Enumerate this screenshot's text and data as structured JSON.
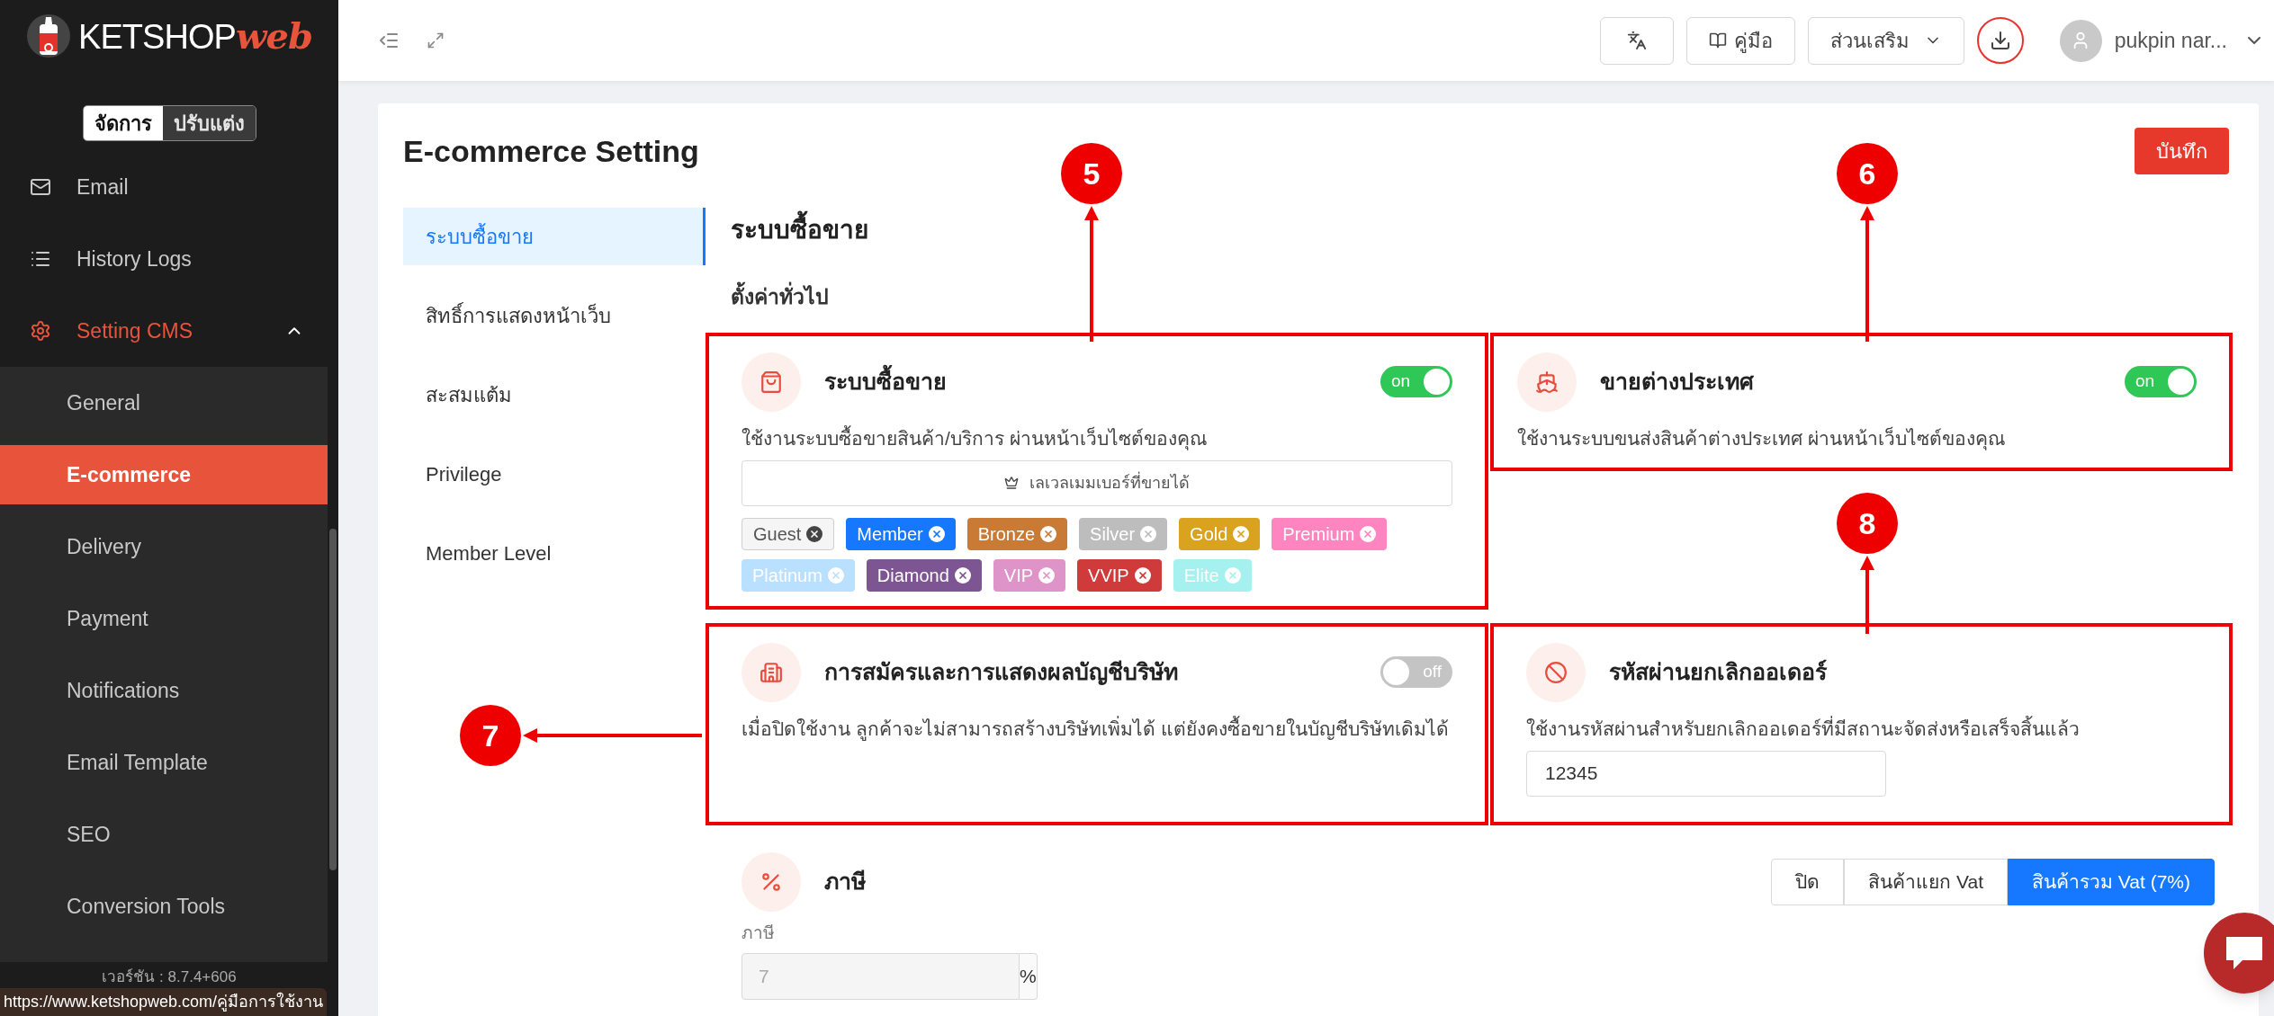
{
  "sidebar": {
    "logo": {
      "text": "KETSHOP",
      "accent": "web"
    },
    "mode_switch": [
      {
        "label": "จัดการ",
        "selected": true
      },
      {
        "label": "ปรับแต่ง",
        "selected": false
      }
    ],
    "items": [
      {
        "label": "Email",
        "selected": false
      },
      {
        "label": "History Logs",
        "selected": false
      },
      {
        "label": "Setting CMS",
        "selected": true,
        "expanded": true,
        "children": [
          {
            "label": "General",
            "selected": false
          },
          {
            "label": "E-commerce",
            "selected": true
          },
          {
            "label": "Delivery",
            "selected": false
          },
          {
            "label": "Payment",
            "selected": false
          },
          {
            "label": "Notifications",
            "selected": false
          },
          {
            "label": "Email Template",
            "selected": false
          },
          {
            "label": "SEO",
            "selected": false
          },
          {
            "label": "Conversion Tools",
            "selected": false
          }
        ]
      }
    ],
    "version": "เวอร์ชัน : 8.7.4+606"
  },
  "status_url": "https://www.ketshopweb.com/คู่มือการใช้งาน",
  "header": {
    "manual_button": "คู่มือ",
    "addons_button": "ส่วนเสริม",
    "user_name": "pukpin nar..."
  },
  "page": {
    "title": "E-commerce Setting",
    "save_button": "บันทึก",
    "tabs": [
      {
        "label": "ระบบซื้อขาย",
        "selected": true
      },
      {
        "label": "สิทธิ์การแสดงหน้าเว็บ",
        "selected": false
      },
      {
        "label": "สะสมแต้ม",
        "selected": false
      },
      {
        "label": "Privilege",
        "selected": false
      },
      {
        "label": "Member Level",
        "selected": false
      }
    ],
    "section_title": "ระบบซื้อขาย",
    "subsection_title": "ตั้งค่าทั่วไป",
    "cards": [
      {
        "kind": "toggle",
        "annotation": "5",
        "title": "ระบบซื้อขาย",
        "on": true,
        "toggle_label": "on",
        "description": "ใช้งานระบบซื้อขายสินค้า/บริการ ผ่านหน้าเว็บไซต์ของคุณ",
        "member_select": {
          "placeholder": "เลเวลเมมเบอร์ที่ขายได้",
          "tags": [
            {
              "label": "Guest",
              "color": "#f5f5f5"
            },
            {
              "label": "Member",
              "color": "#1677ff"
            },
            {
              "label": "Bronze",
              "color": "#c97b35"
            },
            {
              "label": "Silver",
              "color": "#bdbdbd"
            },
            {
              "label": "Gold",
              "color": "#d9a21f"
            },
            {
              "label": "Premium",
              "color": "#ff85c0"
            },
            {
              "label": "Platinum",
              "color": "#bae0ff"
            },
            {
              "label": "Diamond",
              "color": "#7d5592"
            },
            {
              "label": "VIP",
              "color": "#de93c9"
            },
            {
              "label": "VVIP",
              "color": "#cf3b3b"
            },
            {
              "label": "Elite",
              "color": "#a5f1ef"
            }
          ]
        }
      },
      {
        "kind": "toggle",
        "annotation": "6",
        "title": "ขายต่างประเทศ",
        "on": true,
        "toggle_label": "on",
        "description": "ใช้งานระบบขนส่งสินค้าต่างประเทศ ผ่านหน้าเว็บไซต์ของคุณ"
      },
      {
        "kind": "toggle",
        "annotation": "7",
        "title": "การสมัครและการแสดงผลบัญชีบริษัท",
        "on": false,
        "toggle_label": "off",
        "description": "เมื่อปิดใช้งาน ลูกค้าจะไม่สามารถสร้างบริษัทเพิ่มได้ แต่ยังคงซื้อขายในบัญชีบริษัทเดิมได้"
      },
      {
        "kind": "input",
        "annotation": "8",
        "title": "รหัสผ่านยกเลิกออเดอร์",
        "description": "ใช้งานรหัสผ่านสำหรับยกเลิกออเดอร์ที่มีสถานะจัดส่งหรือเสร็จสิ้นแล้ว",
        "value": "12345"
      }
    ],
    "tax": {
      "title": "ภาษี",
      "options": [
        {
          "label": "ปิด",
          "selected": false
        },
        {
          "label": "สินค้าแยก Vat",
          "selected": false
        },
        {
          "label": "สินค้ารวม Vat (7%)",
          "selected": true
        }
      ],
      "field_label": "ภาษี",
      "value": "7",
      "unit": "%",
      "disabled": true
    }
  }
}
